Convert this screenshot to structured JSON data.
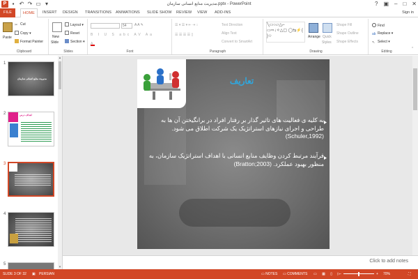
{
  "app": {
    "title": "مدیریت منابع انسانی سازمان.pptx - PowerPoint",
    "app_icon": "P",
    "signin": "Sign in"
  },
  "tabs": [
    "FILE",
    "HOME",
    "INSERT",
    "DESIGN",
    "TRANSITIONS",
    "ANIMATIONS",
    "SLIDE SHOW",
    "REVIEW",
    "VIEW",
    "ADD-INS"
  ],
  "active_tab": "HOME",
  "ribbon": {
    "clipboard": {
      "paste": "Paste",
      "cut": "Cut",
      "copy": "Copy",
      "format_painter": "Format Painter",
      "label": "Clipboard"
    },
    "slides": {
      "new_slide": "New",
      "new_slide2": "Slide",
      "layout": "Layout",
      "reset": "Reset",
      "section": "Section",
      "label": "Slides"
    },
    "font": {
      "size": "54",
      "label": "Font"
    },
    "paragraph": {
      "text_direction": "Text Direction",
      "align_text": "Align Text",
      "smartart": "Convert to SmartArt",
      "label": "Paragraph"
    },
    "drawing": {
      "arrange": "Arrange",
      "quick_styles": "Quick",
      "quick_styles2": "Styles",
      "shape_fill": "Shape Fill",
      "shape_outline": "Shape Outline",
      "shape_effects": "Shape Effects",
      "label": "Drawing"
    },
    "editing": {
      "find": "Find",
      "replace": "Replace",
      "select": "Select",
      "label": "Editing"
    }
  },
  "thumbnails": [
    {
      "num": "1",
      "text": "مدیریت منابع انسانی سازمان"
    },
    {
      "num": "2",
      "text": "اهداف درس"
    },
    {
      "num": "3",
      "text": ""
    },
    {
      "num": "4",
      "text": ""
    },
    {
      "num": "5",
      "text": ""
    }
  ],
  "slide": {
    "title": "تعاریف",
    "para1": "به کلیه ی فعالیت های تاثیر گذار بر رفتار افراد در برانگیختن آن ها به طراحی و اجرای نیازهای استراتژیک یک شرکت اطلاق می شود. (Schuler,1992)",
    "para2": "فرآیند مرتبط کردن وظایف منابع انسانی با اهداف استراتژیک سازمان، به منظور بهبود عملکرد. (Bratton;2003)"
  },
  "notes_placeholder": "Click to add notes",
  "status": {
    "slide_info": "SLIDE 3 OF 32",
    "language": "PERSIAN",
    "notes": "NOTES",
    "comments": "COMMENTS",
    "zoom": "70%"
  },
  "colors": {
    "accent": "#d24726",
    "slide_title": "#2ea8e0"
  }
}
